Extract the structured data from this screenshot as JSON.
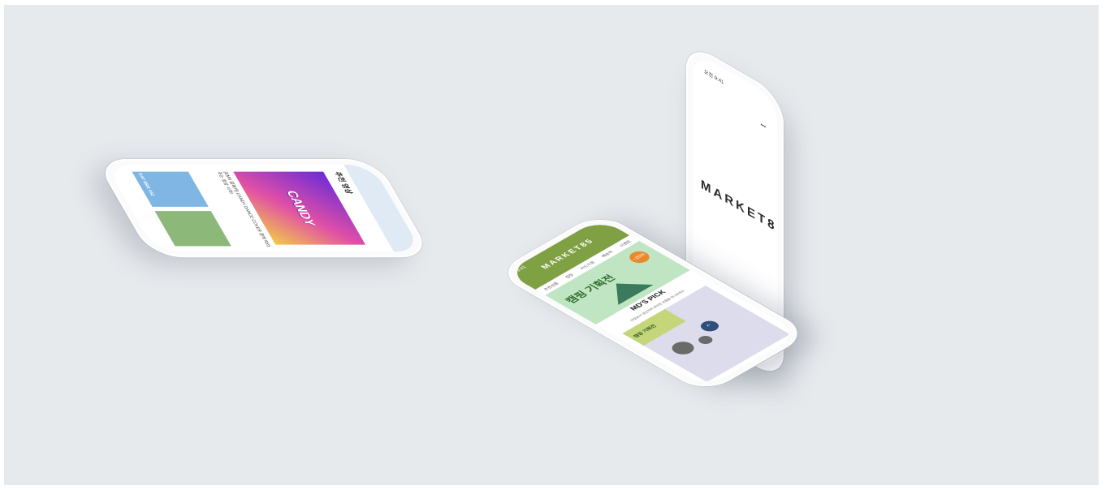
{
  "splash": {
    "brand": "MARKET85",
    "status_left": "오전 9:41",
    "status_right": "▪▪▪"
  },
  "shop": {
    "brand": "MARKET85",
    "status": "9:41",
    "tabs": [
      "추천상품",
      "캠핑",
      "카드지원",
      "배송비",
      "이벤트"
    ],
    "banner_title": "캠핑 기획전",
    "banner_badge": "~25%",
    "section_title": "MD'S PICK",
    "section_sub": "마켓85가 엄선하여 준비한 상품을 만나보세요",
    "card_title": "캠핑 기획전",
    "fab_icon": "arrow-up-icon"
  },
  "side": {
    "title": "추천 영상",
    "image_text": "CANDY",
    "caption": "[EMS 알파카] CANDY DANCE COVER 함께 따라 추는 영상 시작!",
    "thumb_label": "DAY 8501 #52"
  },
  "colors": {
    "background": "#e7eaed",
    "shop_accent": "#7fa043",
    "side_accent": "#dfeaf5"
  }
}
